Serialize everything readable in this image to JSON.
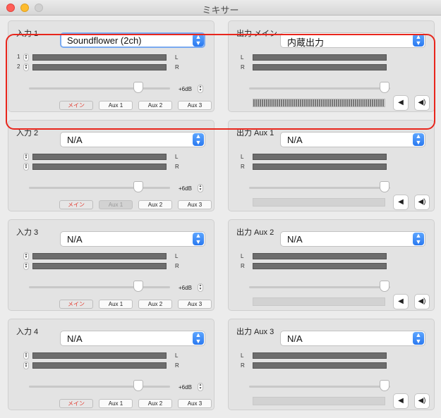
{
  "window": {
    "title": "ミキサー"
  },
  "inputs": [
    {
      "title": "入力 1",
      "source": "Soundflower (2ch)",
      "ch1": "1",
      "ch2": "2",
      "gain": "+6dB",
      "aux1_disabled": false
    },
    {
      "title": "入力 2",
      "source": "N/A",
      "ch1": "",
      "ch2": "",
      "gain": "+6dB",
      "aux1_disabled": true
    },
    {
      "title": "入力 3",
      "source": "N/A",
      "ch1": "",
      "ch2": "",
      "gain": "+6dB",
      "aux1_disabled": false
    },
    {
      "title": "入力 4",
      "source": "N/A",
      "ch1": "",
      "ch2": "",
      "gain": "+6dB",
      "aux1_disabled": false
    }
  ],
  "outputs": [
    {
      "title": "出力 メイン",
      "destination": "内蔵出力",
      "level_active": true
    },
    {
      "title": "出力 Aux 1",
      "destination": "N/A",
      "level_active": false
    },
    {
      "title": "出力 Aux 2",
      "destination": "N/A",
      "level_active": false
    },
    {
      "title": "出力 Aux 3",
      "destination": "N/A",
      "level_active": false
    }
  ],
  "labels": {
    "left": "L",
    "right": "R"
  },
  "buttons": {
    "main": "メイン",
    "aux1": "Aux 1",
    "aux2": "Aux 2",
    "aux3": "Aux 3"
  },
  "icons": {
    "mute": "speaker-icon",
    "volume": "speaker-loud-icon",
    "chevron": "chevron-updown-icon"
  },
  "colors": {
    "main_button_text": "#e23a2f",
    "highlight": "#e8261c",
    "dropdown_accent": "#2a79f0"
  }
}
